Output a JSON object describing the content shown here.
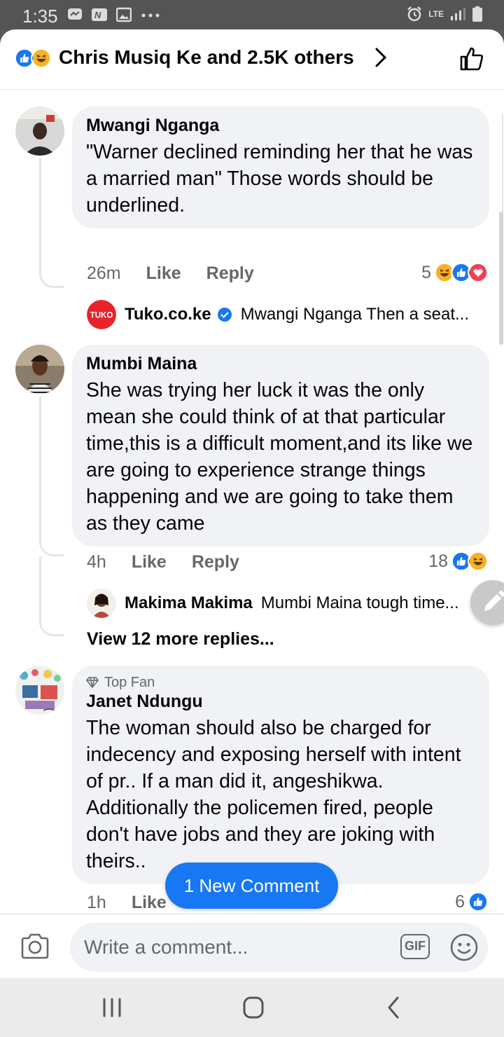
{
  "status_bar": {
    "time": "1:35",
    "network": "LTE"
  },
  "header": {
    "reactions_text": "Chris Musiq Ke and 2.5K others",
    "reaction_icons": [
      "like-icon",
      "haha-icon"
    ]
  },
  "comments": [
    {
      "name": "Mwangi Nganga",
      "text": "\"Warner declined reminding her that he was a married man\" Those words should be underlined.",
      "time": "26m",
      "like": "Like",
      "reply": "Reply",
      "reaction_count": "5",
      "reaction_icons": [
        "haha-icon",
        "like-icon",
        "love-icon"
      ],
      "replies": [
        {
          "avatar_label": "TUKO",
          "name": "Tuko.co.ke",
          "verified": true,
          "preview": "Mwangi Nganga Then a seat..."
        }
      ]
    },
    {
      "name": "Mumbi Maina",
      "text": "She was trying her luck it was the only mean she could think of at that particular time,this is a difficult moment,and its like we are going to experience strange things happening and we are going to take them as they came",
      "time": "4h",
      "like": "Like",
      "reply": "Reply",
      "reaction_count": "18",
      "reaction_icons": [
        "like-icon",
        "haha-icon"
      ],
      "replies": [
        {
          "name": "Makima Makima",
          "preview": "Mumbi Maina tough time..."
        }
      ],
      "view_more": "View 12 more replies..."
    },
    {
      "badge": "Top Fan",
      "name": "Janet Ndungu",
      "text": "The woman should also be charged for indecency and exposing herself with intent of pr.. If a man did it, angeshikwa. Additionally the policemen fired, people don't have jobs and they are joking with theirs..",
      "time": "1h",
      "like": "Like",
      "reaction_count": "6",
      "reaction_icons": [
        "like-icon"
      ]
    }
  ],
  "new_comment_button": "1 New Comment",
  "composer": {
    "placeholder": "Write a comment...",
    "gif_label": "GIF"
  },
  "colors": {
    "facebook_blue": "#1877f2",
    "haha_yellow": "#f7b125",
    "love_red": "#f33e58",
    "bubble_bg": "#f0f2f5",
    "meta_gray": "#65676b"
  }
}
